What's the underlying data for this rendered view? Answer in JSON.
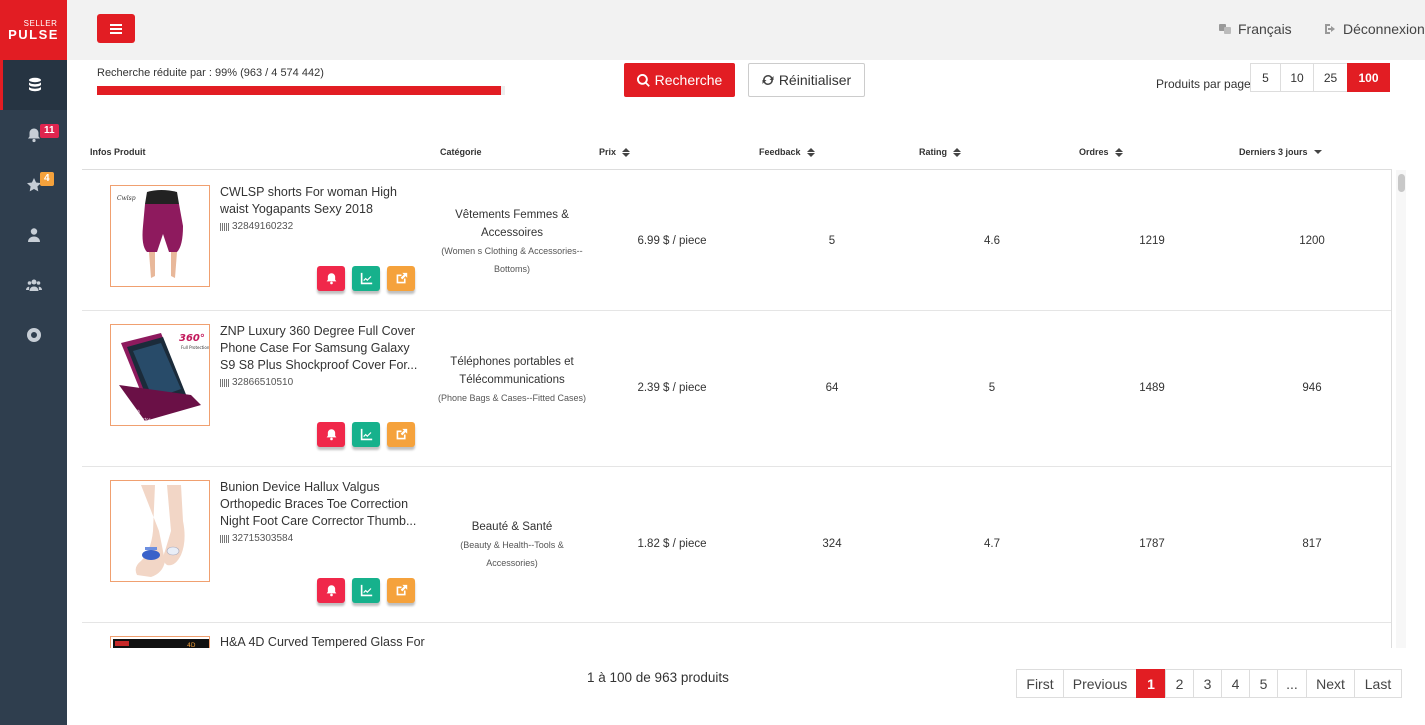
{
  "app": {
    "logo_top": "SELLER",
    "logo_bottom": "PULSE"
  },
  "sidebar": {
    "items": [
      {
        "icon": "database-icon",
        "badge": ""
      },
      {
        "icon": "bell-icon",
        "badge": "11"
      },
      {
        "icon": "star-icon",
        "badge": "4"
      },
      {
        "icon": "user-icon",
        "badge": ""
      },
      {
        "icon": "users-icon",
        "badge": ""
      },
      {
        "icon": "lifebuoy-icon",
        "badge": ""
      }
    ]
  },
  "topbar": {
    "language": "Français",
    "logout": "Déconnexion"
  },
  "filter": {
    "label": "Recherche réduite par : 99% (963 / 4 574 442)",
    "progress": 0.99
  },
  "buttons": {
    "search": "Recherche",
    "reset": "Réinitialiser"
  },
  "per_page": {
    "label": "Produits par page",
    "options": [
      "5",
      "10",
      "25",
      "100"
    ],
    "selected": "100"
  },
  "table": {
    "columns": [
      "Infos Produit",
      "Catégorie",
      "Prix",
      "Feedback",
      "Rating",
      "Ordres",
      "Derniers 3 jours"
    ],
    "rows": [
      {
        "title": "CWLSP shorts For woman High waist Yogapants Sexy 2018",
        "id": "32849160232",
        "category_fr": "Vêtements Femmes & Accessoires",
        "category_en": "(Women s Clothing & Accessories--Bottoms)",
        "price": "6.99 $ / piece",
        "feedback": "5",
        "rating": "4.6",
        "orders": "1219",
        "last3": "1200"
      },
      {
        "title": "ZNP Luxury 360 Degree Full Cover Phone Case For Samsung Galaxy S9 S8 Plus Shockproof Cover For...",
        "id": "32866510510",
        "category_fr": "Téléphones portables et Télécommunications",
        "category_en": "(Phone Bags & Cases--Fitted Cases)",
        "price": "2.39 $ / piece",
        "feedback": "64",
        "rating": "5",
        "orders": "1489",
        "last3": "946"
      },
      {
        "title": "Bunion Device Hallux Valgus Orthopedic Braces Toe Correction Night Foot Care Corrector Thumb...",
        "id": "32715303584",
        "category_fr": "Beauté & Santé",
        "category_en": "(Beauty & Health--Tools & Accessories)",
        "price": "1.82 $ / piece",
        "feedback": "324",
        "rating": "4.7",
        "orders": "1787",
        "last3": "817"
      },
      {
        "title": "H&A 4D Curved Tempered Glass For",
        "id": "",
        "category_fr": "",
        "category_en": "",
        "price": "",
        "feedback": "",
        "rating": "",
        "orders": "",
        "last3": ""
      }
    ]
  },
  "footer": {
    "count": "1 à 100 de 963 produits",
    "pagination": [
      "First",
      "Previous",
      "1",
      "2",
      "3",
      "4",
      "5",
      "...",
      "Next",
      "Last"
    ],
    "current": "1"
  },
  "colors": {
    "brand": "#e21d23",
    "sidebar": "#2f3e4e",
    "bell": "#f0284a",
    "chart": "#16b18c",
    "open": "#f5a23c"
  }
}
